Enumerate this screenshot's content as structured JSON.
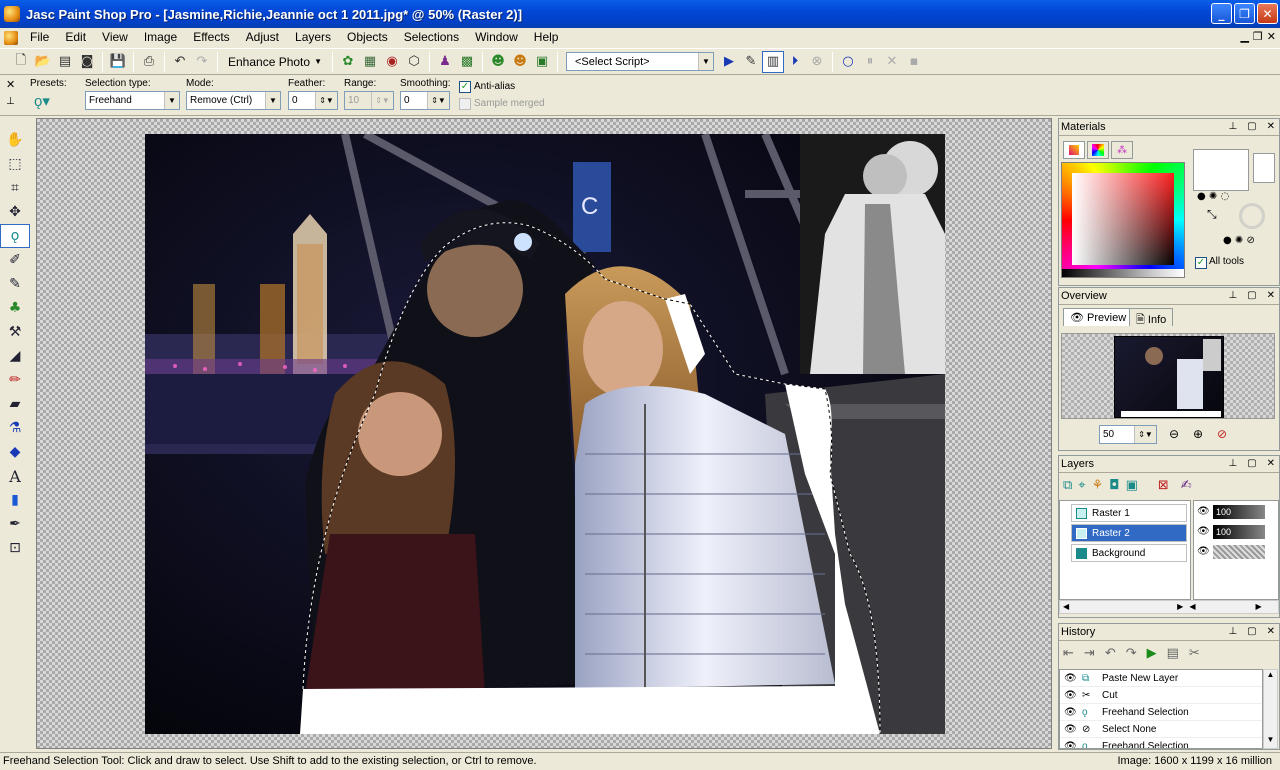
{
  "window": {
    "title": "Jasc Paint Shop Pro - [Jasmine,Richie,Jeannie oct 1 2011.jpg* @  50% (Raster 2)]"
  },
  "menu": [
    "File",
    "Edit",
    "View",
    "Image",
    "Effects",
    "Adjust",
    "Layers",
    "Objects",
    "Selections",
    "Window",
    "Help"
  ],
  "toolbar": {
    "enhance_label": "Enhance Photo",
    "script_select": "<Select Script>"
  },
  "tool_options": {
    "presets_label": "Presets:",
    "selection_type_label": "Selection type:",
    "selection_type_value": "Freehand",
    "mode_label": "Mode:",
    "mode_value": "Remove (Ctrl)",
    "feather_label": "Feather:",
    "feather_value": "0",
    "range_label": "Range:",
    "range_value": "10",
    "smoothing_label": "Smoothing:",
    "smoothing_value": "0",
    "antialias_label": "Anti-alias",
    "sample_merged_label": "Sample merged"
  },
  "materials": {
    "title": "Materials",
    "all_tools_label": "All tools"
  },
  "overview": {
    "title": "Overview",
    "tab_preview": "Preview",
    "tab_info": "Info",
    "zoom_value": "50"
  },
  "layers": {
    "title": "Layers",
    "items": [
      {
        "name": "Raster 1",
        "opacity": "100"
      },
      {
        "name": "Raster 2",
        "opacity": "100"
      },
      {
        "name": "Background",
        "opacity": ""
      }
    ]
  },
  "history": {
    "title": "History",
    "items": [
      "Paste New Layer",
      "Cut",
      "Freehand Selection",
      "Select None",
      "Freehand Selection"
    ]
  },
  "status": {
    "hint": "Freehand Selection Tool: Click and draw to select. Use Shift to add to the existing selection, or Ctrl to remove.",
    "image_info": "Image:  1600 x 1199 x 16 million"
  }
}
